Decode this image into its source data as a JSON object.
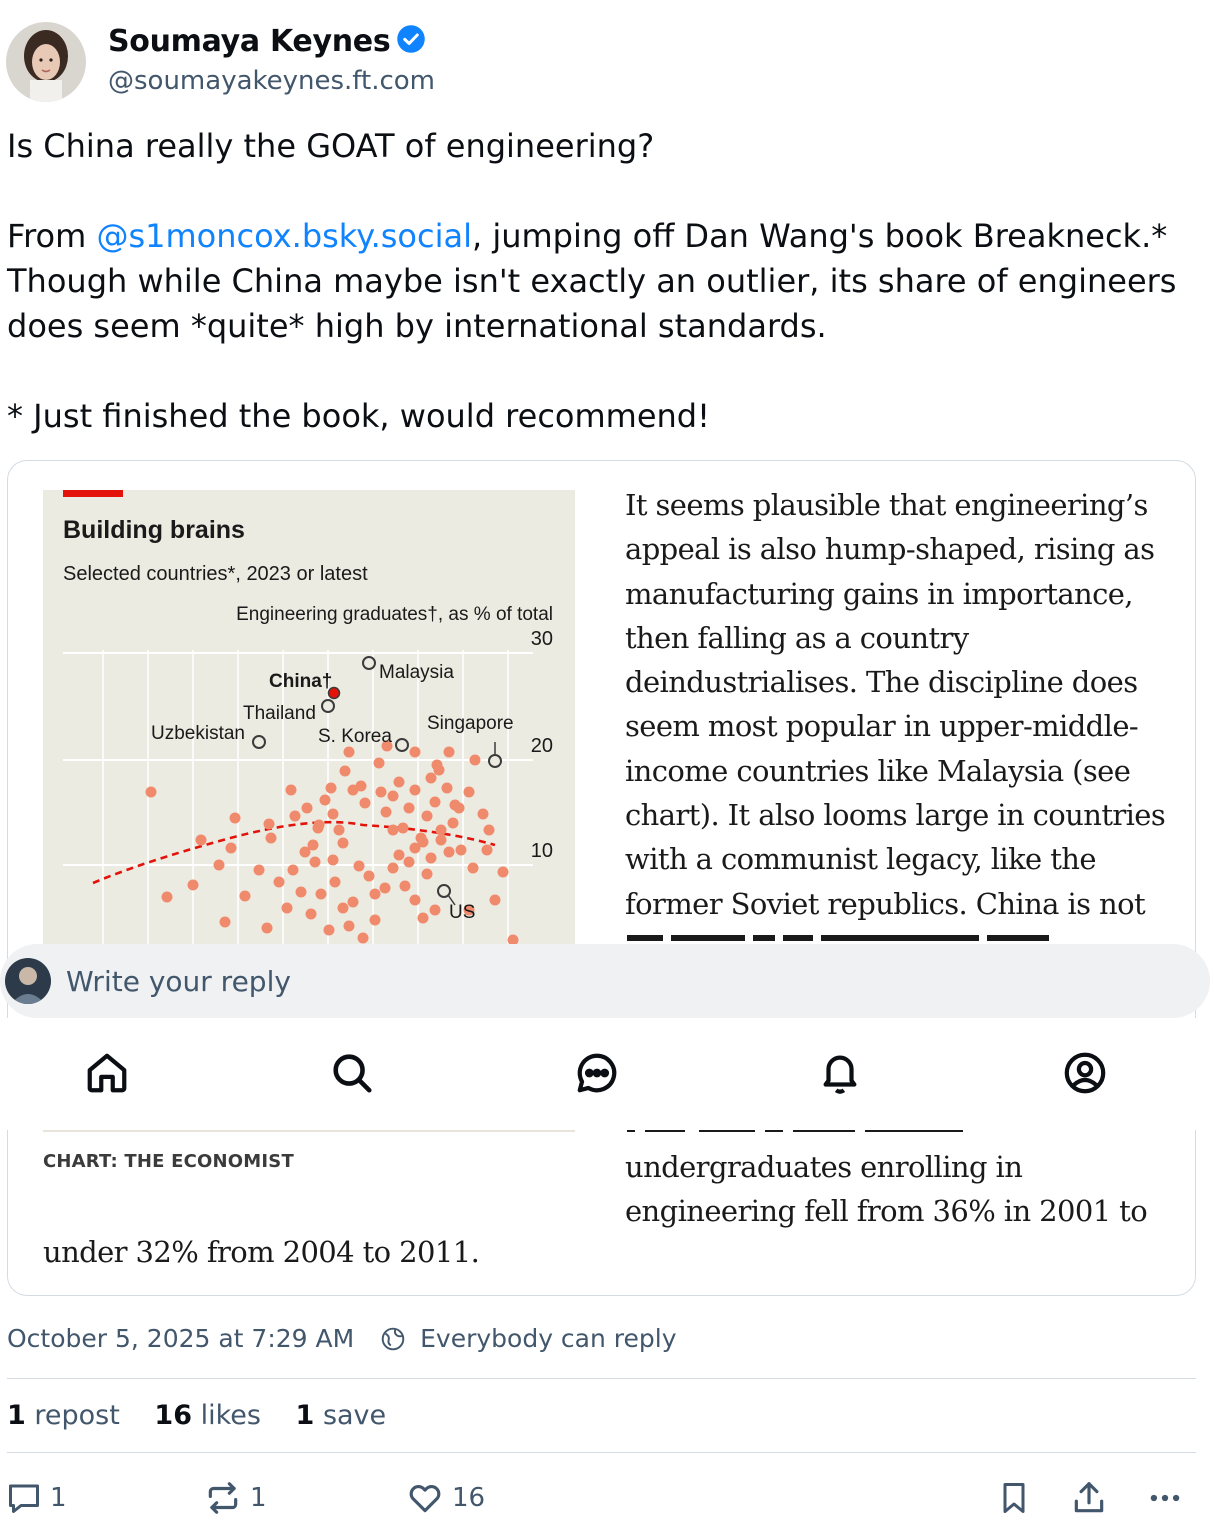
{
  "author": {
    "name": "Soumaya Keynes",
    "handle": "@soumayakeynes.ft.com"
  },
  "post": {
    "line1": "Is China really the GOAT of engineering?",
    "line2_prefix": "From ",
    "line2_mention": "@s1moncox.bsky.social",
    "line2_suffix": ", jumping off Dan Wang's book Breakneck.*",
    "line3": "Though while China maybe isn't exactly an outlier, its share of engineers",
    "line4": "does seem *quite* high by international standards.",
    "line5": "* Just finished the book, would recommend!"
  },
  "embed": {
    "chart": {
      "title": "Building brains",
      "subtitle": "Selected countries*, 2023 or latest",
      "ylabel": "Engineering graduates†, as % of total",
      "ticks": [
        "30",
        "20",
        "10"
      ],
      "labels": {
        "china": "China†",
        "malaysia": "Malaysia",
        "thailand": "Thailand",
        "uzbekistan": "Uzbekistan",
        "skorea": "S. Korea",
        "singapore": "Singapore",
        "us": "US"
      },
      "accent": "#e3120b",
      "dot_color": "#f08a6c",
      "credit": "CHART: THE ECONOMIST"
    },
    "article_lines": [
      "It seems plausible that engineering’s",
      "appeal is also hump-shaped, rising as",
      "manufacturing gains in importance,",
      "then falling as a country",
      "deindustrialises. The discipline does",
      "seem most popular in upper-middle-",
      "income countries like Malaysia (see",
      "chart). It also looms large in countries",
      "with a communist legacy, like the",
      "former Soviet republics. China is not"
    ],
    "article_lines_bottom": [
      "undergraduates enrolling in",
      "engineering fell from 36% in 2001 to"
    ],
    "article_left_bottom": "under 32% from 2004 to 2011."
  },
  "reply": {
    "placeholder": "Write your reply"
  },
  "meta": {
    "timestamp": "October 5, 2025 at 7:29 AM",
    "reply_setting": "Everybody can reply"
  },
  "stats": {
    "reposts_count": "1",
    "reposts_label": "repost",
    "likes_count": "16",
    "likes_label": "likes",
    "saves_count": "1",
    "saves_label": "save"
  },
  "actions": {
    "reply_count": "1",
    "repost_count": "1",
    "like_count": "16"
  },
  "colors": {
    "link": "#1083fe",
    "muted": "#42576c"
  }
}
